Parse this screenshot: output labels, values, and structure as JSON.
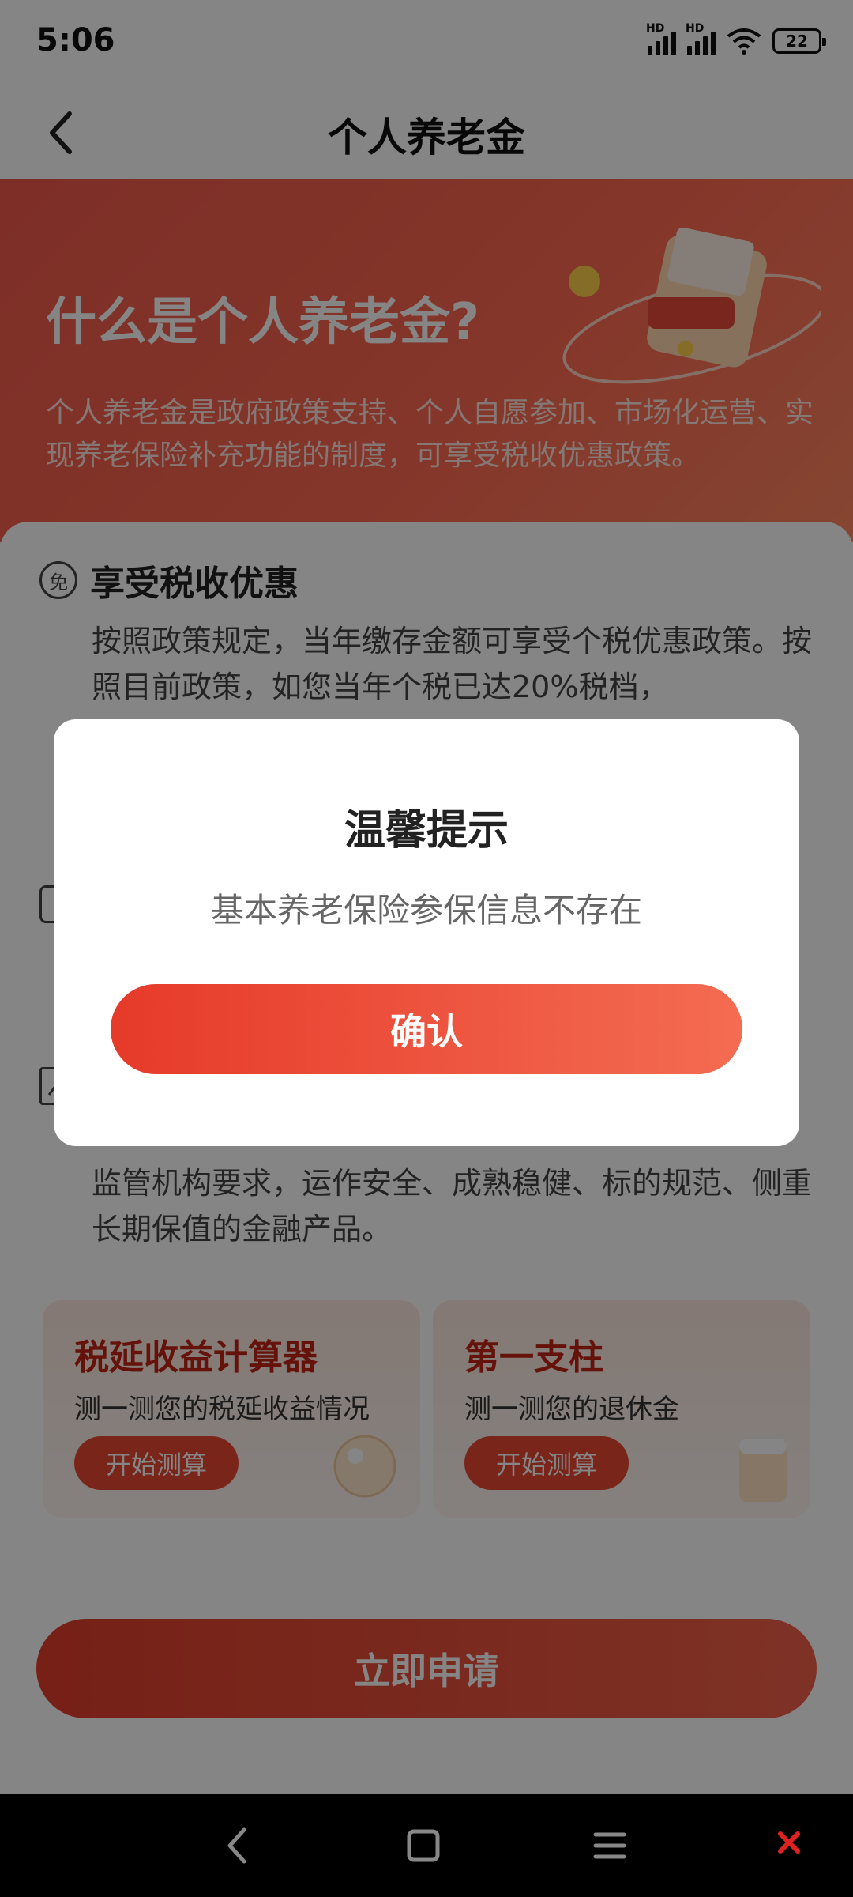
{
  "status_bar": {
    "time": "5:06",
    "battery": "22",
    "signal_label": "HD"
  },
  "nav": {
    "title": "个人养老金"
  },
  "hero": {
    "title": "什么是个人养老金?",
    "description": "个人养老金是政府政策支持、个人自愿参加、市场化运营、实现养老保险补充功能的制度，可享受税收优惠政策。"
  },
  "sections": [
    {
      "icon": "tax-exempt-icon",
      "icon_char": "免",
      "title": "享受税收优惠",
      "body": "按照政策规定，当年缴存金额可享受个税优惠政策。按照目前政策，如您当年个税已达20%税档，"
    },
    {
      "icon": "shield-icon",
      "icon_char": "",
      "title": "",
      "body": ""
    },
    {
      "icon": "trend-chart-icon",
      "icon_char": "",
      "title": "",
      "body": "监管机构要求，运作安全、成熟稳健、标的规范、侧重长期保值的金融产品。"
    }
  ],
  "tools": [
    {
      "title": "税延收益计算器",
      "subtitle": "测一测您的税延收益情况",
      "button": "开始测算"
    },
    {
      "title": "第一支柱",
      "subtitle": "测一测您的退休金",
      "button": "开始测算"
    }
  ],
  "apply": {
    "label": "立即申请"
  },
  "dialog": {
    "title": "温馨提示",
    "message": "基本养老保险参保信息不存在",
    "confirm": "确认"
  },
  "colors": {
    "accent": "#e84733",
    "hero_bg": "#f0584a",
    "tool_title": "#c22415"
  }
}
